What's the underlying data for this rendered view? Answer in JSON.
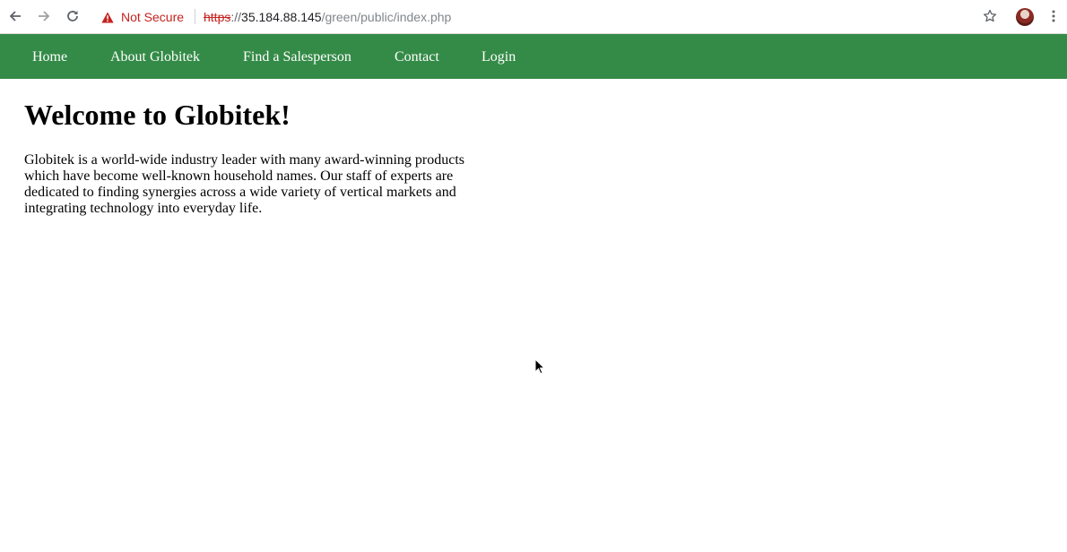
{
  "browser": {
    "security_label": "Not Secure",
    "url": {
      "scheme": "https",
      "separator": "://",
      "host": "35.184.88.145",
      "path": "/green/public/index.php"
    },
    "icons": {
      "back": "arrow-left-icon",
      "forward": "arrow-right-icon",
      "reload": "reload-icon",
      "warning": "warning-triangle-icon",
      "bookmark": "star-icon",
      "profile": "avatar",
      "menu": "kebab-menu-icon"
    },
    "colors": {
      "not_secure": "#c5221f"
    }
  },
  "nav": {
    "background": "#348b47",
    "items": [
      {
        "label": "Home"
      },
      {
        "label": "About Globitek"
      },
      {
        "label": "Find a Salesperson"
      },
      {
        "label": "Contact"
      },
      {
        "label": "Login"
      }
    ]
  },
  "main": {
    "heading": "Welcome to Globitek!",
    "paragraph": "Globitek is a world-wide industry leader with many award-winning products which have become well-known household names. Our staff of experts are dedicated to finding synergies across a wide variety of vertical markets and integrating technology into everyday life."
  }
}
